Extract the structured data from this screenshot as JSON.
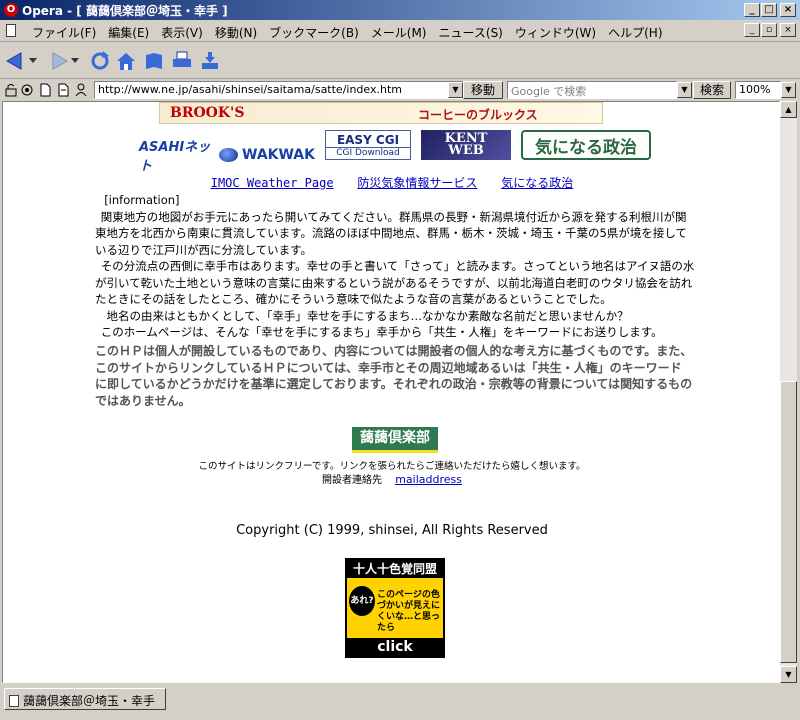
{
  "window": {
    "title": "Opera - [ 藹藹倶楽部＠埼玉・幸手 ]",
    "app_icon_letter": "O",
    "minimize": "_",
    "maximize": "□",
    "close": "×"
  },
  "menu": {
    "items": [
      "ファイル(F)",
      "編集(E)",
      "表示(V)",
      "移動(N)",
      "ブックマーク(B)",
      "メール(M)",
      "ニュース(S)",
      "ウィンドウ(W)",
      "ヘルプ(H)"
    ]
  },
  "address": {
    "url": "http://www.ne.jp/asahi/shinsei/saitama/satte/index.htm",
    "go_label": "移動",
    "search_placeholder": "Google で検索",
    "search_label": "検索",
    "zoom": "100%"
  },
  "banners": {
    "brooks": "BROOK'S",
    "brooks_jp": "コーヒーのブルックス",
    "asahi": "ASAHIネット",
    "wakwak": "WAKWAK",
    "easycgi_title": "EASY CGI",
    "easycgi_sub": "CGI Download",
    "kent_1": "KENT",
    "kent_2": "WEB",
    "kininaru": "気になる政治"
  },
  "links": {
    "imoc": "IMOC Weather Page",
    "bousai": "防災気象情報サービス",
    "seiji": "気になる政治"
  },
  "information": {
    "heading": "[information]",
    "p1": "関東地方の地図がお手元にあったら開いてみてください。群馬県の長野・新潟県境付近から源を発する利根川が関東地方を北西から南東に貫流しています。流路のほぼ中間地点、群馬・栃木・茨城・埼玉・千葉の5県が境を接している辺りで江戸川が西に分流しています。",
    "p2": "その分流点の西側に幸手市はあります。幸せの手と書いて「さって」と読みます。さってという地名はアイヌ語の水が引いて乾いた土地という意味の言葉に由来するという説があるそうですが、以前北海道白老町のウタリ協会を訪れたときにその話をしたところ、確かにそういう意味で似たような音の言葉があるということでした。",
    "p3": "地名の由来はともかくとして、「幸手」幸せを手にするまち…なかなか素敵な名前だと思いませんか？",
    "p4": "このホームページは、そんな「幸せを手にするまち」幸手から「共生・人権」をキーワードにお送りします。"
  },
  "disclaimer": "このＨＰは個人が開設しているものであり、内容については開設者の個人的な考え方に基づくものです。また、このサイトからリンクしているＨＰについては、幸手市とその周辺地域あるいは「共生・人権」のキーワードに即しているかどうかだけを基準に選定しております。それぞれの政治・宗教等の背景については関知するものではありません。",
  "footer": {
    "club_logo": "藹藹倶楽部",
    "linkfree": "このサイトはリンクフリーです。リンクを張られたらご連絡いただけたら嬉しく想います。",
    "contact_label": "開設者連絡先",
    "contact_link": "mailaddress",
    "copyright": "Copyright (C) 1999, shinsei, All Rights Reserved",
    "color_banner_top": "十人十色覚同盟",
    "color_banner_are": "あれ?",
    "color_banner_text": "このページの色づかいが見えにくいな…と思ったら",
    "color_banner_click": "click"
  },
  "status": {
    "tab_title": "藹藹倶楽部＠埼玉・幸手"
  }
}
